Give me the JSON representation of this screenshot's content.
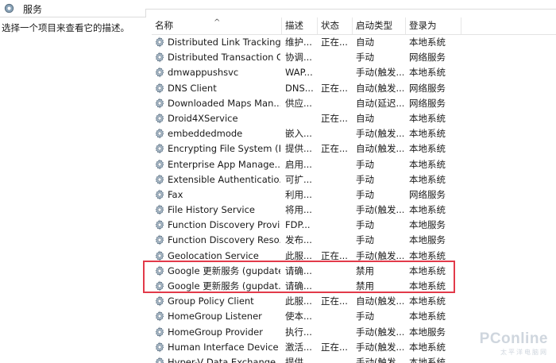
{
  "window": {
    "title": "服务",
    "icon": "services-gear-icon"
  },
  "description_pane": {
    "hint": "选择一个项目来查看它的描述。"
  },
  "columns": {
    "name": "名称",
    "description": "描述",
    "status": "状态",
    "startup_type": "启动类型",
    "logon_as": "登录为"
  },
  "services": [
    {
      "name": "Distributed Link Tracking...",
      "description": "维护...",
      "status": "正在...",
      "startup": "自动",
      "logon": "本地系统"
    },
    {
      "name": "Distributed Transaction C...",
      "description": "协调...",
      "status": "",
      "startup": "手动",
      "logon": "网络服务"
    },
    {
      "name": "dmwappushsvc",
      "description": "WAP...",
      "status": "",
      "startup": "手动(触发...",
      "logon": "本地系统"
    },
    {
      "name": "DNS Client",
      "description": "DNS...",
      "status": "正在...",
      "startup": "自动(触发...",
      "logon": "网络服务"
    },
    {
      "name": "Downloaded Maps Man...",
      "description": "供应...",
      "status": "",
      "startup": "自动(延迟...",
      "logon": "网络服务"
    },
    {
      "name": "Droid4XService",
      "description": "",
      "status": "正在...",
      "startup": "自动",
      "logon": "本地系统"
    },
    {
      "name": "embeddedmode",
      "description": "嵌入...",
      "status": "",
      "startup": "手动(触发...",
      "logon": "本地系统"
    },
    {
      "name": "Encrypting File System (E...",
      "description": "提供...",
      "status": "正在...",
      "startup": "自动(触发...",
      "logon": "本地系统"
    },
    {
      "name": "Enterprise App Manage...",
      "description": "启用...",
      "status": "",
      "startup": "手动",
      "logon": "本地系统"
    },
    {
      "name": "Extensible Authenticatio...",
      "description": "可扩...",
      "status": "",
      "startup": "手动",
      "logon": "本地系统"
    },
    {
      "name": "Fax",
      "description": "利用...",
      "status": "",
      "startup": "手动",
      "logon": "网络服务"
    },
    {
      "name": "File History Service",
      "description": "将用...",
      "status": "",
      "startup": "手动(触发...",
      "logon": "本地系统"
    },
    {
      "name": "Function Discovery Provi...",
      "description": "FDP...",
      "status": "",
      "startup": "手动",
      "logon": "本地服务"
    },
    {
      "name": "Function Discovery Reso...",
      "description": "发布...",
      "status": "",
      "startup": "手动",
      "logon": "本地服务"
    },
    {
      "name": "Geolocation Service",
      "description": "此服...",
      "status": "正在...",
      "startup": "手动(触发...",
      "logon": "本地系统"
    },
    {
      "name": "Google 更新服务 (gupdate)",
      "description": "请确...",
      "status": "",
      "startup": "禁用",
      "logon": "本地系统"
    },
    {
      "name": "Google 更新服务 (gupdat...",
      "description": "请确...",
      "status": "",
      "startup": "禁用",
      "logon": "本地系统"
    },
    {
      "name": "Group Policy Client",
      "description": "此服...",
      "status": "正在...",
      "startup": "自动(触发...",
      "logon": "本地系统"
    },
    {
      "name": "HomeGroup Listener",
      "description": "使本...",
      "status": "",
      "startup": "手动",
      "logon": "本地系统"
    },
    {
      "name": "HomeGroup Provider",
      "description": "执行...",
      "status": "",
      "startup": "手动(触发...",
      "logon": "本地服务"
    },
    {
      "name": "Human Interface Device ...",
      "description": "激活...",
      "status": "正在...",
      "startup": "手动(触发...",
      "logon": "本地系统"
    },
    {
      "name": "Hyper-V Data Exchange ...",
      "description": "提供...",
      "status": "",
      "startup": "手动(触发...",
      "logon": "本地系统"
    }
  ],
  "annotation": {
    "highlight_color": "#e23a4a"
  },
  "watermark": {
    "line1": "PConline",
    "line2": "太平洋电脑网"
  }
}
